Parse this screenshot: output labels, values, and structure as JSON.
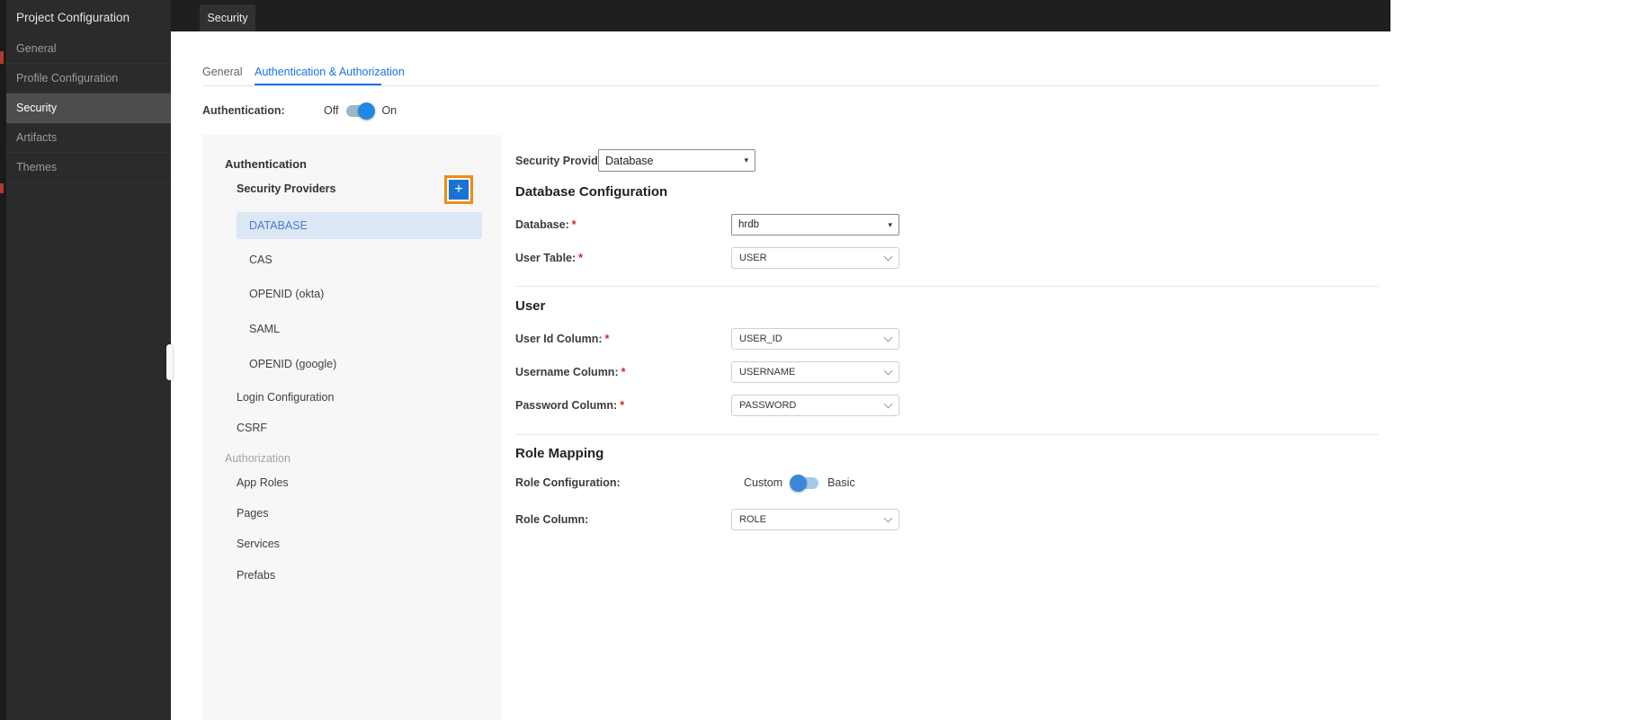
{
  "sidebar": {
    "title": "Project Configuration",
    "items": [
      "General",
      "Profile Configuration",
      "Security",
      "Artifacts",
      "Themes"
    ],
    "selected": "Security"
  },
  "topbar": {
    "tab": "Security"
  },
  "tabs": {
    "general": "General",
    "auth": "Authentication & Authorization",
    "selected": "Authentication & Authorization"
  },
  "authentication": {
    "label": "Authentication:",
    "off": "Off",
    "on": "On",
    "state": "On"
  },
  "tree": {
    "section_authentication": "Authentication",
    "providers_header": "Security Providers",
    "add_label": "+",
    "providers": [
      "DATABASE",
      "CAS",
      "OPENID (okta)",
      "SAML",
      "OPENID (google)"
    ],
    "selected_provider": "DATABASE",
    "login_configuration": "Login Configuration",
    "csrf": "CSRF",
    "section_authorization": "Authorization",
    "authorization_items": [
      "App Roles",
      "Pages",
      "Services",
      "Prefabs"
    ]
  },
  "form": {
    "required_marker": "*",
    "security_provider": {
      "label": "Security Provider",
      "value": "Database"
    },
    "section_database": {
      "title": "Database Configuration"
    },
    "database": {
      "label": "Database:",
      "value": "hrdb"
    },
    "user_table": {
      "label": "User Table:",
      "value": "USER"
    },
    "section_user": {
      "title": "User"
    },
    "user_id_column": {
      "label": "User Id Column:",
      "value": "USER_ID"
    },
    "username_column": {
      "label": "Username Column:",
      "value": "USERNAME"
    },
    "password_column": {
      "label": "Password Column:",
      "value": "PASSWORD"
    },
    "section_role": {
      "title": "Role Mapping"
    },
    "role_configuration": {
      "label": "Role Configuration:",
      "left": "Custom",
      "right": "Basic",
      "selected": "Custom"
    },
    "role_column": {
      "label": "Role Column:",
      "value": "ROLE"
    }
  },
  "colors": {
    "accent_blue": "#1e88e5",
    "tab_blue": "#1a73e8",
    "highlight_orange": "#f08c12",
    "sidebar_bg": "#2b2b2b",
    "panel_bg": "#f7f7f7",
    "selected_tree_bg": "#dce7f6",
    "required_red": "#e02020"
  }
}
